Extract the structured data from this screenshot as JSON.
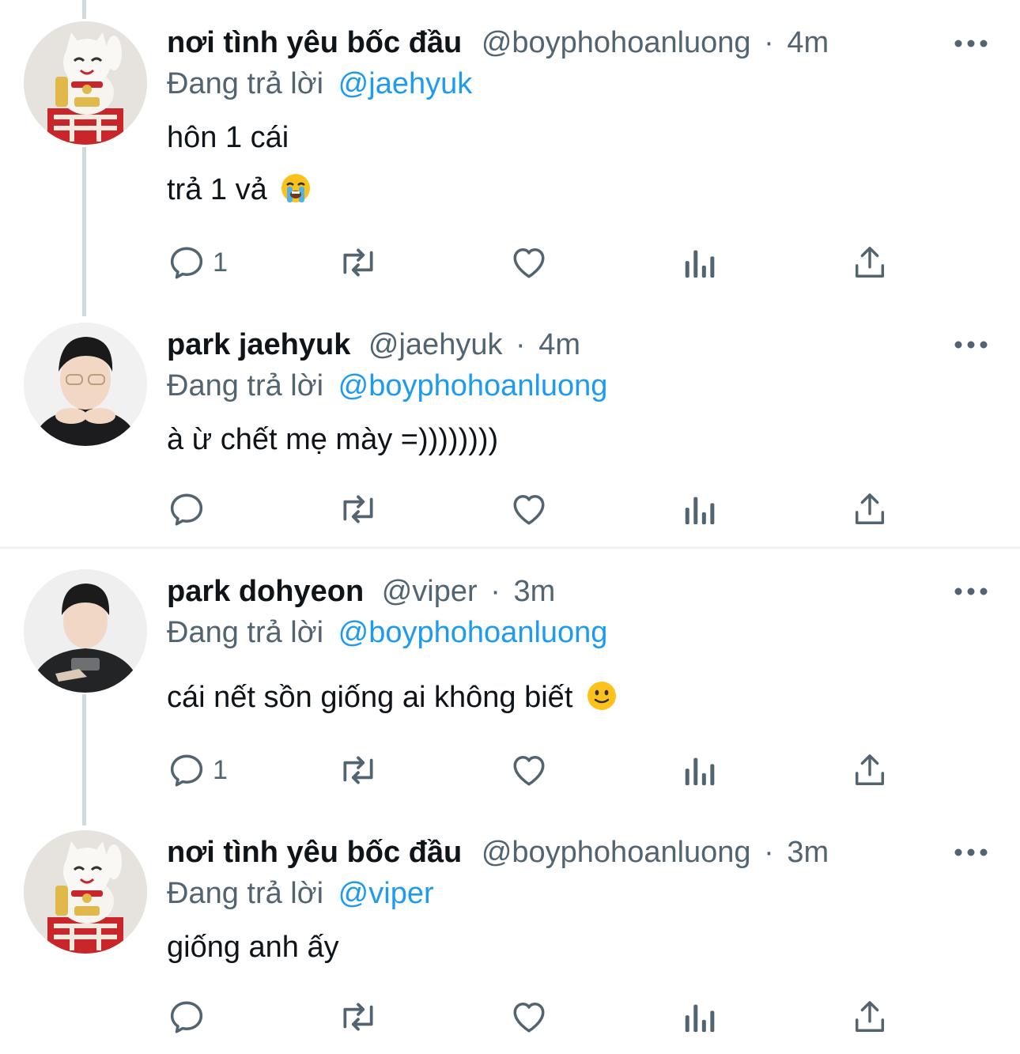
{
  "colors": {
    "text": "#0f1419",
    "secondary": "#536471",
    "accent": "#1d9bf0",
    "thread_line": "#cfd9de",
    "divider": "#eff3f4"
  },
  "tweets": [
    {
      "name": "nơi tình yêu bốc đầu",
      "handle": "@boyphohoanluong",
      "separator": "·",
      "time": "4m",
      "reply_prefix": "Đang trả lời",
      "reply_to": "@jaehyuk",
      "lines": [
        "hôn 1 cái",
        "trả 1 vả"
      ],
      "emoji": "loudly-crying-face-icon",
      "reply_count": "1",
      "avatar": "lucky-cat-avatar"
    },
    {
      "name": "park jaehyuk",
      "handle": "@jaehyuk",
      "separator": "·",
      "time": "4m",
      "reply_prefix": "Đang trả lời",
      "reply_to": "@boyphohoanluong",
      "lines": [
        "à ừ chết mẹ mày =))))))))"
      ],
      "reply_count": "",
      "avatar": "person-avatar"
    },
    {
      "name": "park dohyeon",
      "handle": "@viper",
      "separator": "·",
      "time": "3m",
      "reply_prefix": "Đang trả lời",
      "reply_to": "@boyphohoanluong",
      "lines": [
        "cái nết sồn giống ai không biết"
      ],
      "emoji": "slightly-smiling-face-icon",
      "reply_count": "1",
      "avatar": "person-avatar"
    },
    {
      "name": "nơi tình yêu bốc đầu",
      "handle": "@boyphohoanluong",
      "separator": "·",
      "time": "3m",
      "reply_prefix": "Đang trả lời",
      "reply_to": "@viper",
      "lines": [
        "giống anh ấy"
      ],
      "reply_count": "",
      "avatar": "lucky-cat-avatar"
    }
  ],
  "icons": {
    "reply": "reply-icon",
    "retweet": "retweet-icon",
    "like": "like-icon",
    "views": "views-icon",
    "share": "share-icon",
    "more": "more-icon"
  }
}
